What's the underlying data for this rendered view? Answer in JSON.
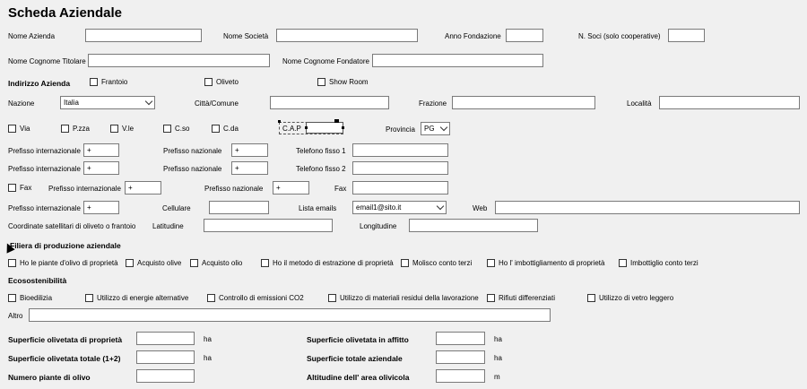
{
  "title": "Scheda Aziendale",
  "labels": {
    "nome_azienda": "Nome Azienda",
    "nome_societa": "Nome Società",
    "anno_fondazione": "Anno Fondazione",
    "n_soci": "N.  Soci (solo cooperative)",
    "nome_titolare": "Nome Cognome Titolare",
    "nome_fondatore": "Nome Cognome Fondatore",
    "indirizzo_azienda": "Indirizzo Azienda",
    "nazione": "Nazione",
    "citta": "Città/Comune",
    "frazione": "Frazione",
    "localita": "Località",
    "provincia": "Provincia",
    "cap": "C.A.P",
    "prefisso_int_1": "Prefisso internazionale",
    "prefisso_naz_1": "Prefisso nazionale",
    "telefono_fisso_1": "Telefono fisso 1",
    "prefisso_int_2": "Prefisso internazionale",
    "prefisso_naz_2": "Prefisso nazionale",
    "telefono_fisso_2": "Telefono fisso 2",
    "prefisso_int_fax": "Prefisso internazionale",
    "prefisso_naz_fax": "Prefisso nazionale",
    "fax_field": "Fax",
    "prefisso_int_cell": "Prefisso internazionale",
    "cellulare": "Cellulare",
    "lista_emails": "Lista emails",
    "web": "Web",
    "coordinate": "Coordinate satellitari di oliveto o frantoio",
    "latitudine": "Latitudine",
    "longitudine": "Longitudine",
    "filiera": "Filiera di produzione aziendale",
    "ecosostenibilita": "Ecosostenibilità",
    "altro": "Altro",
    "sup_proprieta": "Superficie olivetata di proprietà",
    "sup_affitto": "Superficie olivetata in affitto",
    "sup_totale_12": "Superficie olivetata totale (1+2)",
    "sup_totale_az": "Superficie totale aziendale",
    "numero_piante": "Numero piante di olivo",
    "altitudine": "Altitudine dell' area olivicola",
    "unit_ha": "ha",
    "unit_m": "m"
  },
  "checkboxes": {
    "frantoio": "Frantoio",
    "oliveto": "Oliveto",
    "show_room": "Show Room",
    "via": "Via",
    "pzza": "P.zza",
    "vle": "V.le",
    "cso": "C.so",
    "cda": "C.da",
    "fax": "Fax",
    "filiera": [
      "Ho le piante d'olivo di proprietà",
      "Acquisto olive",
      "Acquisto olio",
      "Ho il metodo di estrazione di proprietà",
      "Molisco conto terzi",
      "Ho l' imbottigliamento di proprietà",
      "Imbottiglio conto terzi"
    ],
    "eco": [
      "Bioedilizia",
      "Utilizzo di energie alternative",
      "Controllo di emissioni CO2",
      "Utilizzo di materiali residui della lavorazione",
      "Rifiuti differenziati",
      "Utilizzo di vetro leggero"
    ]
  },
  "values": {
    "nazione": "Italia",
    "provincia": "PG",
    "plus": "+",
    "email": "email1@sito.it"
  }
}
